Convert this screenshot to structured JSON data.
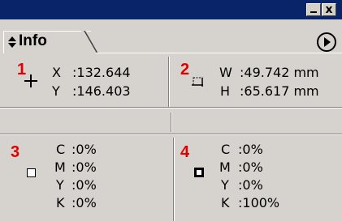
{
  "panel": {
    "tab_label": "Info"
  },
  "titlebar": {
    "close_glyph": "x"
  },
  "icons": {
    "tab_arrows": "up-down-arrows-icon",
    "menu": "circle-play-icon",
    "crosshair": "crosshair-plus-icon",
    "marquee": "dashed-selection-icon",
    "color_3": "hollow-square-icon",
    "color_4": "filled-square-icon"
  },
  "colors": {
    "title_bar": "#0a246a",
    "panel_bg": "#d6d3ce",
    "annotation_number": "#e00000"
  },
  "sections": {
    "position": {
      "number": "1",
      "x_label": "X",
      "x_value": ":132.644",
      "y_label": "Y",
      "y_value": ":146.403"
    },
    "size": {
      "number": "2",
      "w_label": "W",
      "w_value": ":49.742 mm",
      "h_label": "H",
      "h_value": ":65.617 mm"
    },
    "color_a": {
      "number": "3",
      "c_label": "C",
      "c_value": ":0%",
      "m_label": "M",
      "m_value": ":0%",
      "y_label": "Y",
      "y_value": ":0%",
      "k_label": "K",
      "k_value": ":0%"
    },
    "color_b": {
      "number": "4",
      "c_label": "C",
      "c_value": ":0%",
      "m_label": "M",
      "m_value": ":0%",
      "y_label": "Y",
      "y_value": ":0%",
      "k_label": "K",
      "k_value": ":100%"
    }
  }
}
